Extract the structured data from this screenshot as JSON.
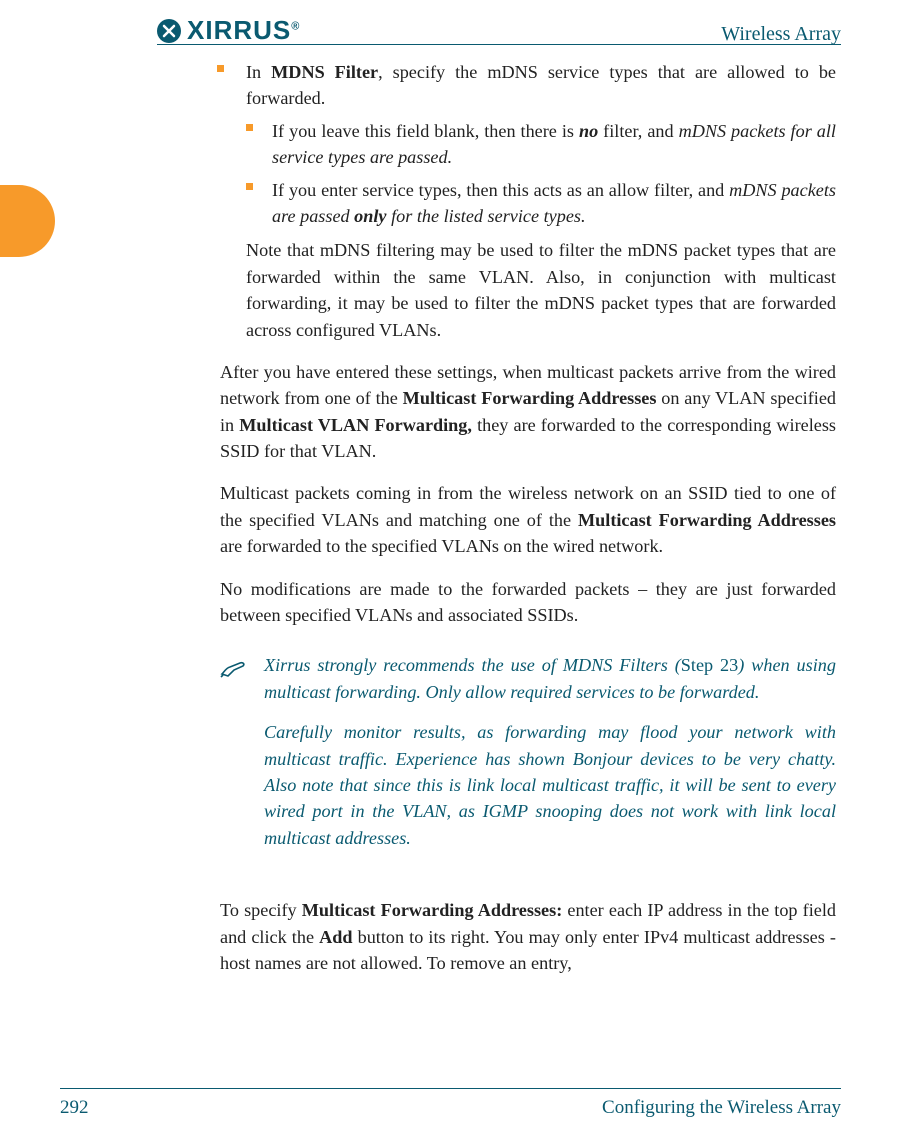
{
  "header": {
    "brand": "XIRRUS",
    "book_title": "Wireless Array"
  },
  "body": {
    "item1": {
      "lead_text": "In ",
      "bold1": "MDNS Filter",
      "rest": ", specify the mDNS service types that are allowed to be forwarded."
    },
    "sub1": {
      "normal_pre": "If you leave this field blank, then there is ",
      "bold_ital_no": "no",
      "mid": " filter, and ",
      "ital_tail": "mDNS packets for all service types are passed."
    },
    "sub2": {
      "normal_pre": "If you enter service types, then this acts as an allow filter, and ",
      "ital_pre": "mDNS packets are passed ",
      "bold_ital_only": "only",
      "ital_tail": " for the listed service types."
    },
    "note_para": "Note that mDNS filtering may be used to filter the mDNS packet types that are forwarded within the same VLAN. Also, in conjunction with multicast forwarding, it may be used to filter the mDNS packet types that are forwarded across configured VLANs.",
    "after1_pre": "After you have entered these settings, when multicast packets arrive from the wired network from one of the ",
    "after1_b1": "Multicast Forwarding Addresses",
    "after1_mid": " on any VLAN specified in ",
    "after1_b2": "Multicast VLAN Forwarding,",
    "after1_tail": " they are forwarded to the corresponding wireless SSID for that VLAN.",
    "after2_pre": "Multicast packets coming in from the wireless network on an SSID tied to one of the specified VLANs and matching one of the ",
    "after2_b1": "Multicast Forwarding Addresses",
    "after2_tail": " are forwarded to the specified VLANs on the wired network.",
    "after3": "No modifications are made to the forwarded packets – they are just forwarded between specified VLANs and associated SSIDs.",
    "callout": {
      "p1_pre": "Xirrus strongly recommends the use of MDNS Filters (",
      "p1_step": "Step 23",
      "p1_tail": ") when using multicast forwarding. Only allow required services to be forwarded.",
      "p2": "Carefully monitor results, as forwarding may flood your network with multicast traffic. Experience has shown Bonjour devices to be very chatty. Also note that since this is link local multicast traffic, it will be sent to every wired port in the VLAN, as IGMP snooping does not work with link local multicast addresses."
    },
    "tail_pre": "To specify ",
    "tail_b1": "Multicast Forwarding Addresses:",
    "tail_mid": " enter each IP address in the top field and click the ",
    "tail_b2": "Add",
    "tail_end": " button to its right. You may only enter IPv4 multicast addresses - host names are not allowed. To remove an entry,"
  },
  "footer": {
    "page_number": "292",
    "section": "Configuring the Wireless Array"
  }
}
